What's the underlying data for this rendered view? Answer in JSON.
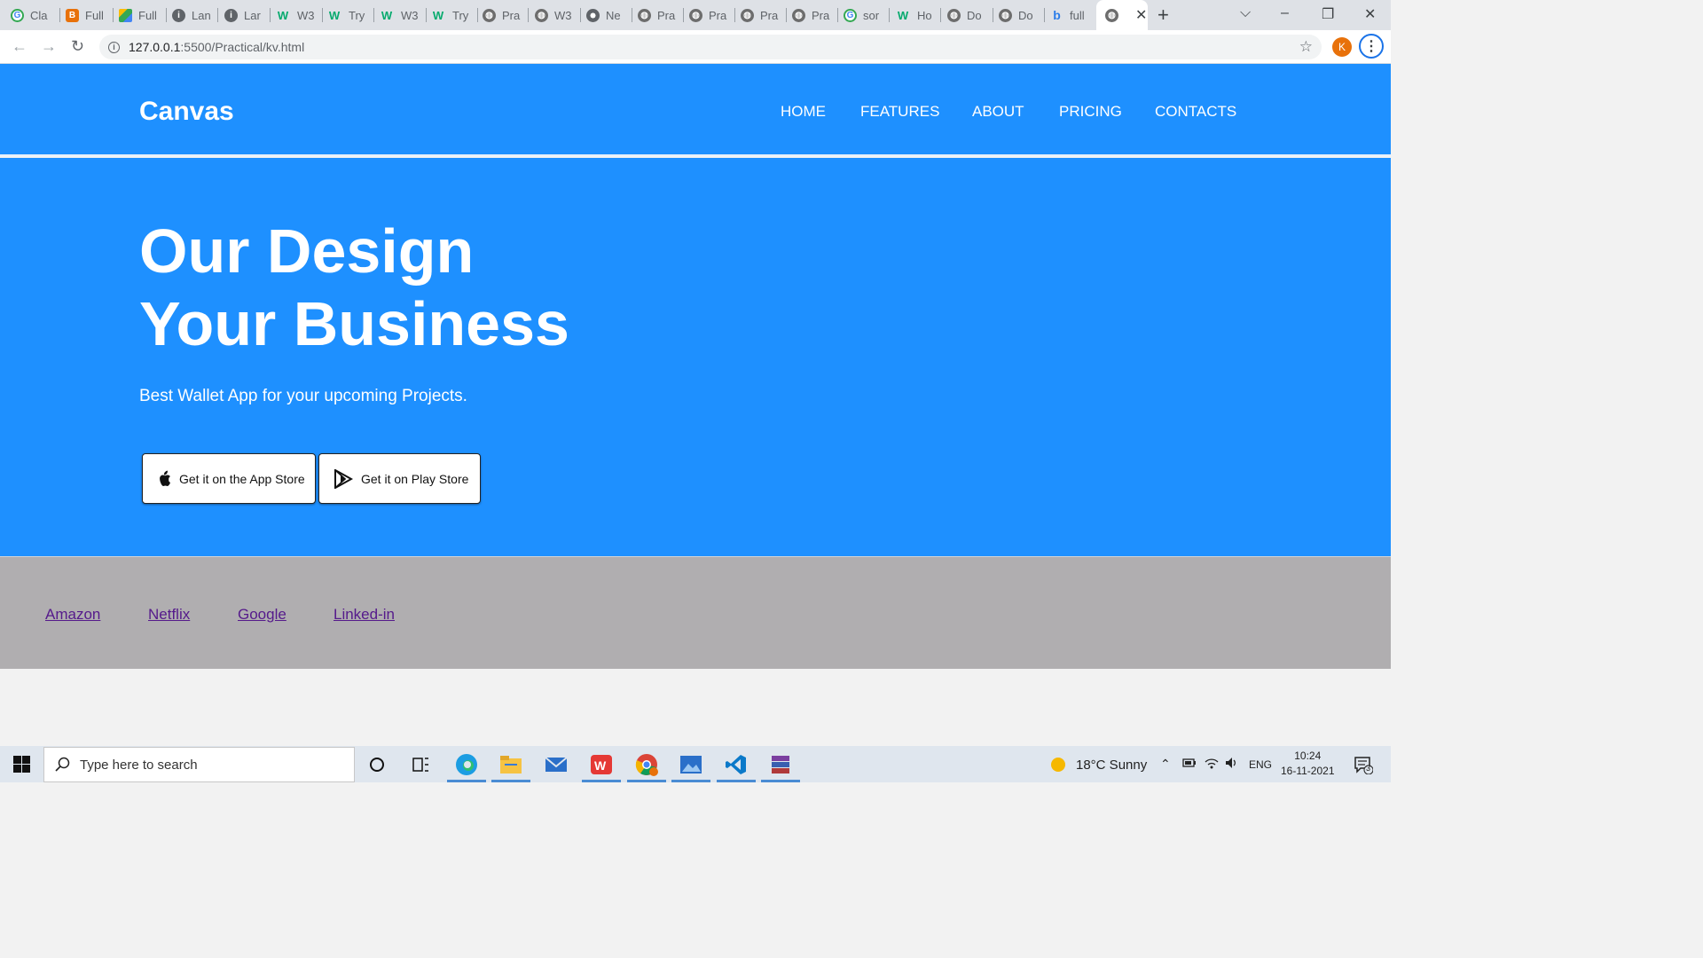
{
  "browser": {
    "tabs": [
      {
        "label": "Cla",
        "icon": "google-icon"
      },
      {
        "label": "Full",
        "icon": "blogger-icon"
      },
      {
        "label": "Full",
        "icon": "drive-icon"
      },
      {
        "label": "Lan",
        "icon": "info-icon"
      },
      {
        "label": "Lar",
        "icon": "info-icon"
      },
      {
        "label": "W3",
        "icon": "w3schools-icon"
      },
      {
        "label": "Try",
        "icon": "w3schools-icon"
      },
      {
        "label": "W3",
        "icon": "w3schools-icon"
      },
      {
        "label": "Try",
        "icon": "w3schools-icon"
      },
      {
        "label": "Pra",
        "icon": "globe-icon"
      },
      {
        "label": "W3",
        "icon": "globe-icon"
      },
      {
        "label": "Ne",
        "icon": "chrome-icon"
      },
      {
        "label": "Pra",
        "icon": "globe-icon"
      },
      {
        "label": "Pra",
        "icon": "globe-icon"
      },
      {
        "label": "Pra",
        "icon": "globe-icon"
      },
      {
        "label": "Pra",
        "icon": "globe-icon"
      },
      {
        "label": "sor",
        "icon": "google-icon"
      },
      {
        "label": "Ho",
        "icon": "w3schools-icon"
      },
      {
        "label": "Do",
        "icon": "globe-icon"
      },
      {
        "label": "Do",
        "icon": "globe-icon"
      },
      {
        "label": "full",
        "icon": "bing-icon"
      }
    ],
    "url_host": "127.0.0.1",
    "url_path": ":5500/Practical/kv.html",
    "profile_initial": "K"
  },
  "site": {
    "brand": "Canvas",
    "nav": [
      "HOME",
      "FEATURES",
      "ABOUT",
      "PRICING",
      "CONTACTS"
    ],
    "hero_line1": "Our Design",
    "hero_line2": "Your Business",
    "hero_sub": "Best Wallet App for your upcoming Projects.",
    "app_store_btn": "Get it on the App Store",
    "play_store_btn": "Get it on Play Store",
    "footer_links": [
      "Amazon",
      "Netflix",
      "Google",
      "Linked-in"
    ]
  },
  "taskbar": {
    "search_placeholder": "Type here to search",
    "weather": "18°C  Sunny",
    "lang": "ENG",
    "time": "10:24",
    "date": "16-11-2021",
    "notif_count": "3"
  },
  "colors": {
    "page_blue": "#1e90ff",
    "footer_gray": "#b0aeb0",
    "visited_link": "#551a8b"
  }
}
